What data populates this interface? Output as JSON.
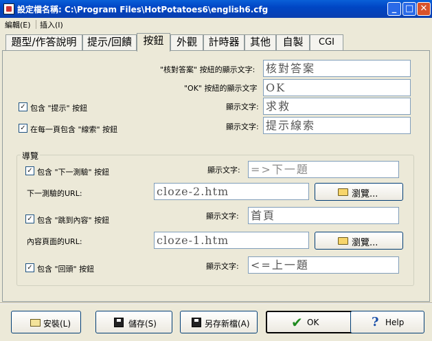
{
  "window": {
    "title": "設定檔名稱: C:\\Program Files\\HotPotatoes6\\english6.cfg",
    "min": "_",
    "max": "□",
    "close": "✕"
  },
  "menu": {
    "items": [
      "編輯(E)",
      "插入(I)"
    ]
  },
  "tabs": [
    {
      "label": "題型/作答說明",
      "active": false
    },
    {
      "label": "提示/回饋",
      "active": false
    },
    {
      "label": "按鈕",
      "active": true
    },
    {
      "label": "外觀",
      "active": false
    },
    {
      "label": "計時器",
      "active": false
    },
    {
      "label": "其他",
      "active": false
    },
    {
      "label": "自製",
      "active": false
    },
    {
      "label": "CGI",
      "active": false
    }
  ],
  "buttons_section": {
    "check_label": "\"核對答案\" 按紐的顯示文字:",
    "check_value": "核對答案",
    "ok_label": "\"OK\" 按紐的顯示文字",
    "ok_value": "OK",
    "hint_checkbox": "包含 \"提示\" 按鈕",
    "hint_checked": true,
    "hint_text_label": "顯示文字:",
    "hint_value": "求救",
    "clue_checkbox": "在每一頁包含 \"線索\" 按鈕",
    "clue_checked": true,
    "clue_text_label": "顯示文字:",
    "clue_value": "提示線索"
  },
  "navigation": {
    "group_title": "導覽",
    "next_checkbox": "包含 \"下一測驗\" 按鈕",
    "next_checked": true,
    "next_text_label": "顯示文字:",
    "next_value": "=>下一題",
    "next_url_label": "下一測驗的URL:",
    "next_url_value": "cloze-2.htm",
    "browse1": "瀏覽...",
    "contents_checkbox": "包含 \"跳到內容\" 按鈕",
    "contents_checked": true,
    "contents_text_label": "顯示文字:",
    "contents_value": "首頁",
    "contents_url_label": "內容頁面的URL:",
    "contents_url_value": "cloze-1.htm",
    "browse2": "瀏覽...",
    "back_checkbox": "包含 \"回頭\" 按鈕",
    "back_checked": true,
    "back_text_label": "顯示文字:",
    "back_value": "<=上一題"
  },
  "footer": {
    "install": "安裝(L)",
    "save": "儲存(S)",
    "save_as": "另存新檔(A)",
    "ok": "OK",
    "help": "Help"
  },
  "colors": {
    "title_bar": "#0a5fd8",
    "window_bg": "#ece9d8",
    "field_border": "#7f9db9",
    "ok_check": "#1f8a1f"
  }
}
